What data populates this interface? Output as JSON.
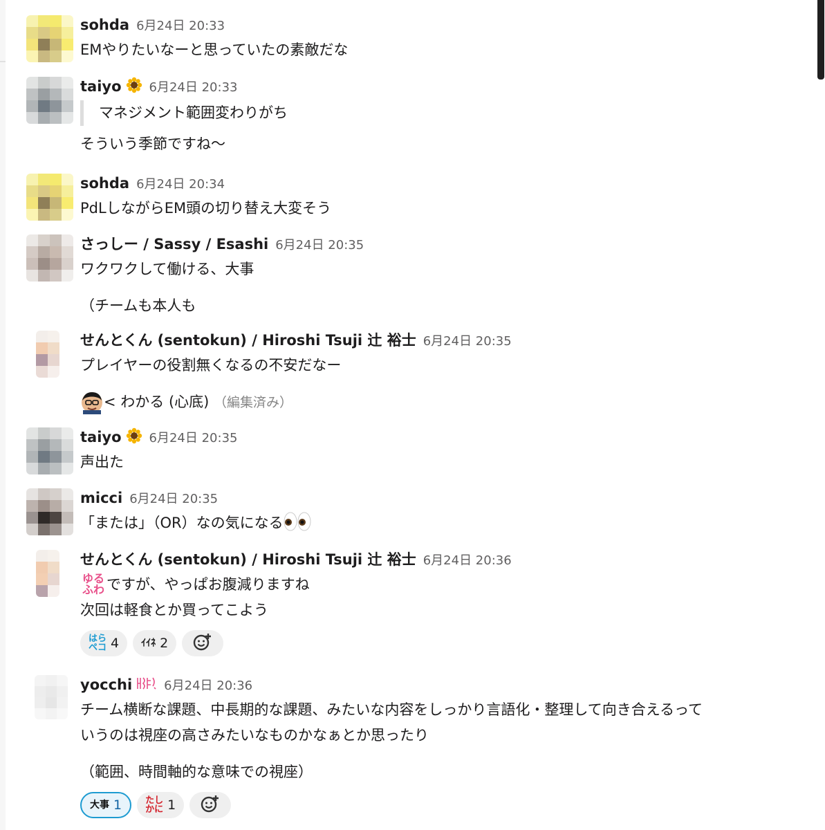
{
  "messages": [
    {
      "author": "sohda",
      "timestamp": "6月24日 20:33",
      "lines": [
        "EMやりたいなーと思っていたの素敵だな"
      ]
    },
    {
      "author": "taiyo",
      "author_emoji": "sunflower-icon",
      "timestamp": "6月24日 20:33",
      "quote": "マネジメント範囲変わりがち",
      "lines": [
        "そういう季節ですね〜"
      ]
    },
    {
      "author": "sohda",
      "timestamp": "6月24日 20:34",
      "lines": [
        "PdLしながらEM頭の切り替え大変そう"
      ]
    },
    {
      "author": "さっしー / Sassy / Esashi",
      "timestamp": "6月24日 20:35",
      "lines": [
        "ワクワクして働ける、大事",
        "（チームも本人も"
      ]
    },
    {
      "author": "せんとくん (sentokun) / Hiroshi Tsuji 辻 裕士",
      "timestamp": "6月24日 20:35",
      "lines": [
        "プレイヤーの役割無くなるの不安だなー"
      ],
      "reply_text": "< わかる (心底)",
      "edited_label": "（編集済み）"
    },
    {
      "author": "taiyo",
      "author_emoji": "sunflower-icon",
      "timestamp": "6月24日 20:35",
      "lines": [
        "声出た"
      ]
    },
    {
      "author": "micci",
      "timestamp": "6月24日 20:35",
      "lines": [
        "「または」（OR）なの気になる"
      ]
    },
    {
      "author": "せんとくん (sentokun) / Hiroshi Tsuji 辻 裕士",
      "timestamp": "6月24日 20:36",
      "lines": [
        "ですが、やっぱお腹減りますね",
        "次回は軽食とか買ってこよう"
      ],
      "stamp_text": "ゆる\nふわ",
      "reactions": [
        {
          "stamp": "はら\nペコ",
          "count": "4"
        },
        {
          "stamp": "ｲｲﾈ",
          "count": "2"
        }
      ]
    },
    {
      "author": "yocchi",
      "timestamp": "6月24日 20:36",
      "lines": [
        "チーム横断な課題、中長期的な課題、みたいな内容をしっかり言語化・整理して向き合えるって",
        "いうのは視座の高さみたいなものかなぁとか思ったり",
        "（範囲、時間軸的な意味での視座）"
      ],
      "reactions": [
        {
          "stamp": "大事",
          "count": "1",
          "active": true
        },
        {
          "stamp": "たし\nかに",
          "count": "1"
        }
      ]
    }
  ],
  "colors": {
    "link_blue": "#1264a3",
    "reaction_active_border": "#1d9bd1",
    "timestamp_gray": "#616061"
  }
}
